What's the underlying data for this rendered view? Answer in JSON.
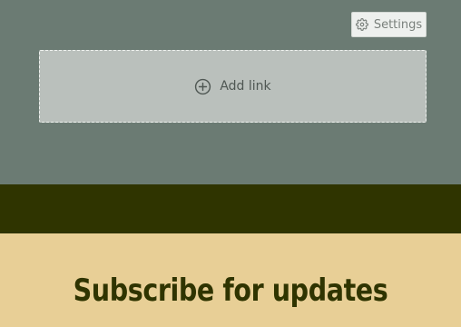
{
  "header": {
    "settings_label": "Settings",
    "settings_icon": "gear-icon"
  },
  "links_block": {
    "add_link_label": "Add link",
    "add_link_icon": "plus-circle-icon"
  },
  "subscribe": {
    "heading": "Subscribe for updates"
  },
  "colors": {
    "top_background": "#6b7b73",
    "dark_band": "#2f3400",
    "subscribe_background": "#e8cf96",
    "heading_text": "#2f3400"
  }
}
